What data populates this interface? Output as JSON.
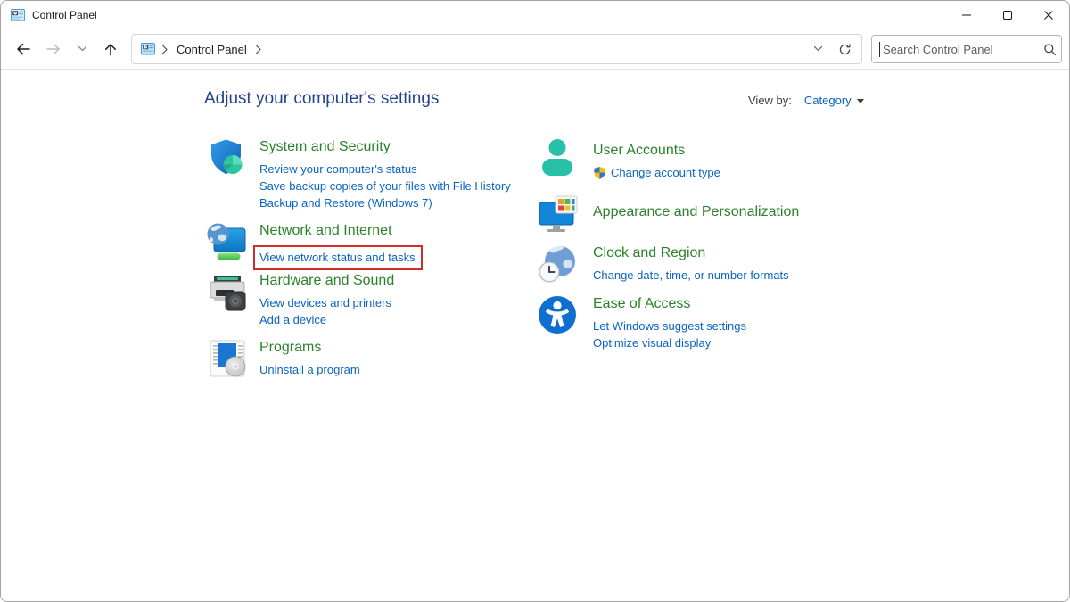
{
  "titlebar": {
    "title": "Control Panel"
  },
  "toolbar": {
    "breadcrumb_root": "Control Panel",
    "search_placeholder": "Search Control Panel"
  },
  "header": {
    "title": "Adjust your computer's settings",
    "view_by_label": "View by:",
    "view_by_value": "Category"
  },
  "categories": {
    "left": [
      {
        "title": "System and Security",
        "icon": "shield-icon",
        "links": [
          {
            "label": "Review your computer's status"
          },
          {
            "label": "Save backup copies of your files with File History"
          },
          {
            "label": "Backup and Restore (Windows 7)"
          }
        ]
      },
      {
        "title": "Network and Internet",
        "icon": "network-globe-icon",
        "links": [
          {
            "label": "View network status and tasks",
            "highlighted": true
          }
        ]
      },
      {
        "title": "Hardware and Sound",
        "icon": "printer-icon",
        "links": [
          {
            "label": "View devices and printers"
          },
          {
            "label": "Add a device"
          }
        ]
      },
      {
        "title": "Programs",
        "icon": "program-disc-icon",
        "links": [
          {
            "label": "Uninstall a program"
          }
        ]
      }
    ],
    "right": [
      {
        "title": "User Accounts",
        "icon": "user-icon",
        "links": [
          {
            "label": "Change account type",
            "uac_shield": true
          }
        ]
      },
      {
        "title": "Appearance and Personalization",
        "icon": "personalization-icon",
        "links": []
      },
      {
        "title": "Clock and Region",
        "icon": "clock-globe-icon",
        "links": [
          {
            "label": "Change date, time, or number formats"
          }
        ]
      },
      {
        "title": "Ease of Access",
        "icon": "accessibility-icon",
        "links": [
          {
            "label": "Let Windows suggest settings"
          },
          {
            "label": "Optimize visual display"
          }
        ]
      }
    ]
  },
  "colors": {
    "category_title_green": "#2a832a",
    "link_blue": "#0a64c0",
    "page_title_navy": "#24428f",
    "highlight_red": "#d22d26",
    "window_border_gray": "#a3a3a3"
  }
}
